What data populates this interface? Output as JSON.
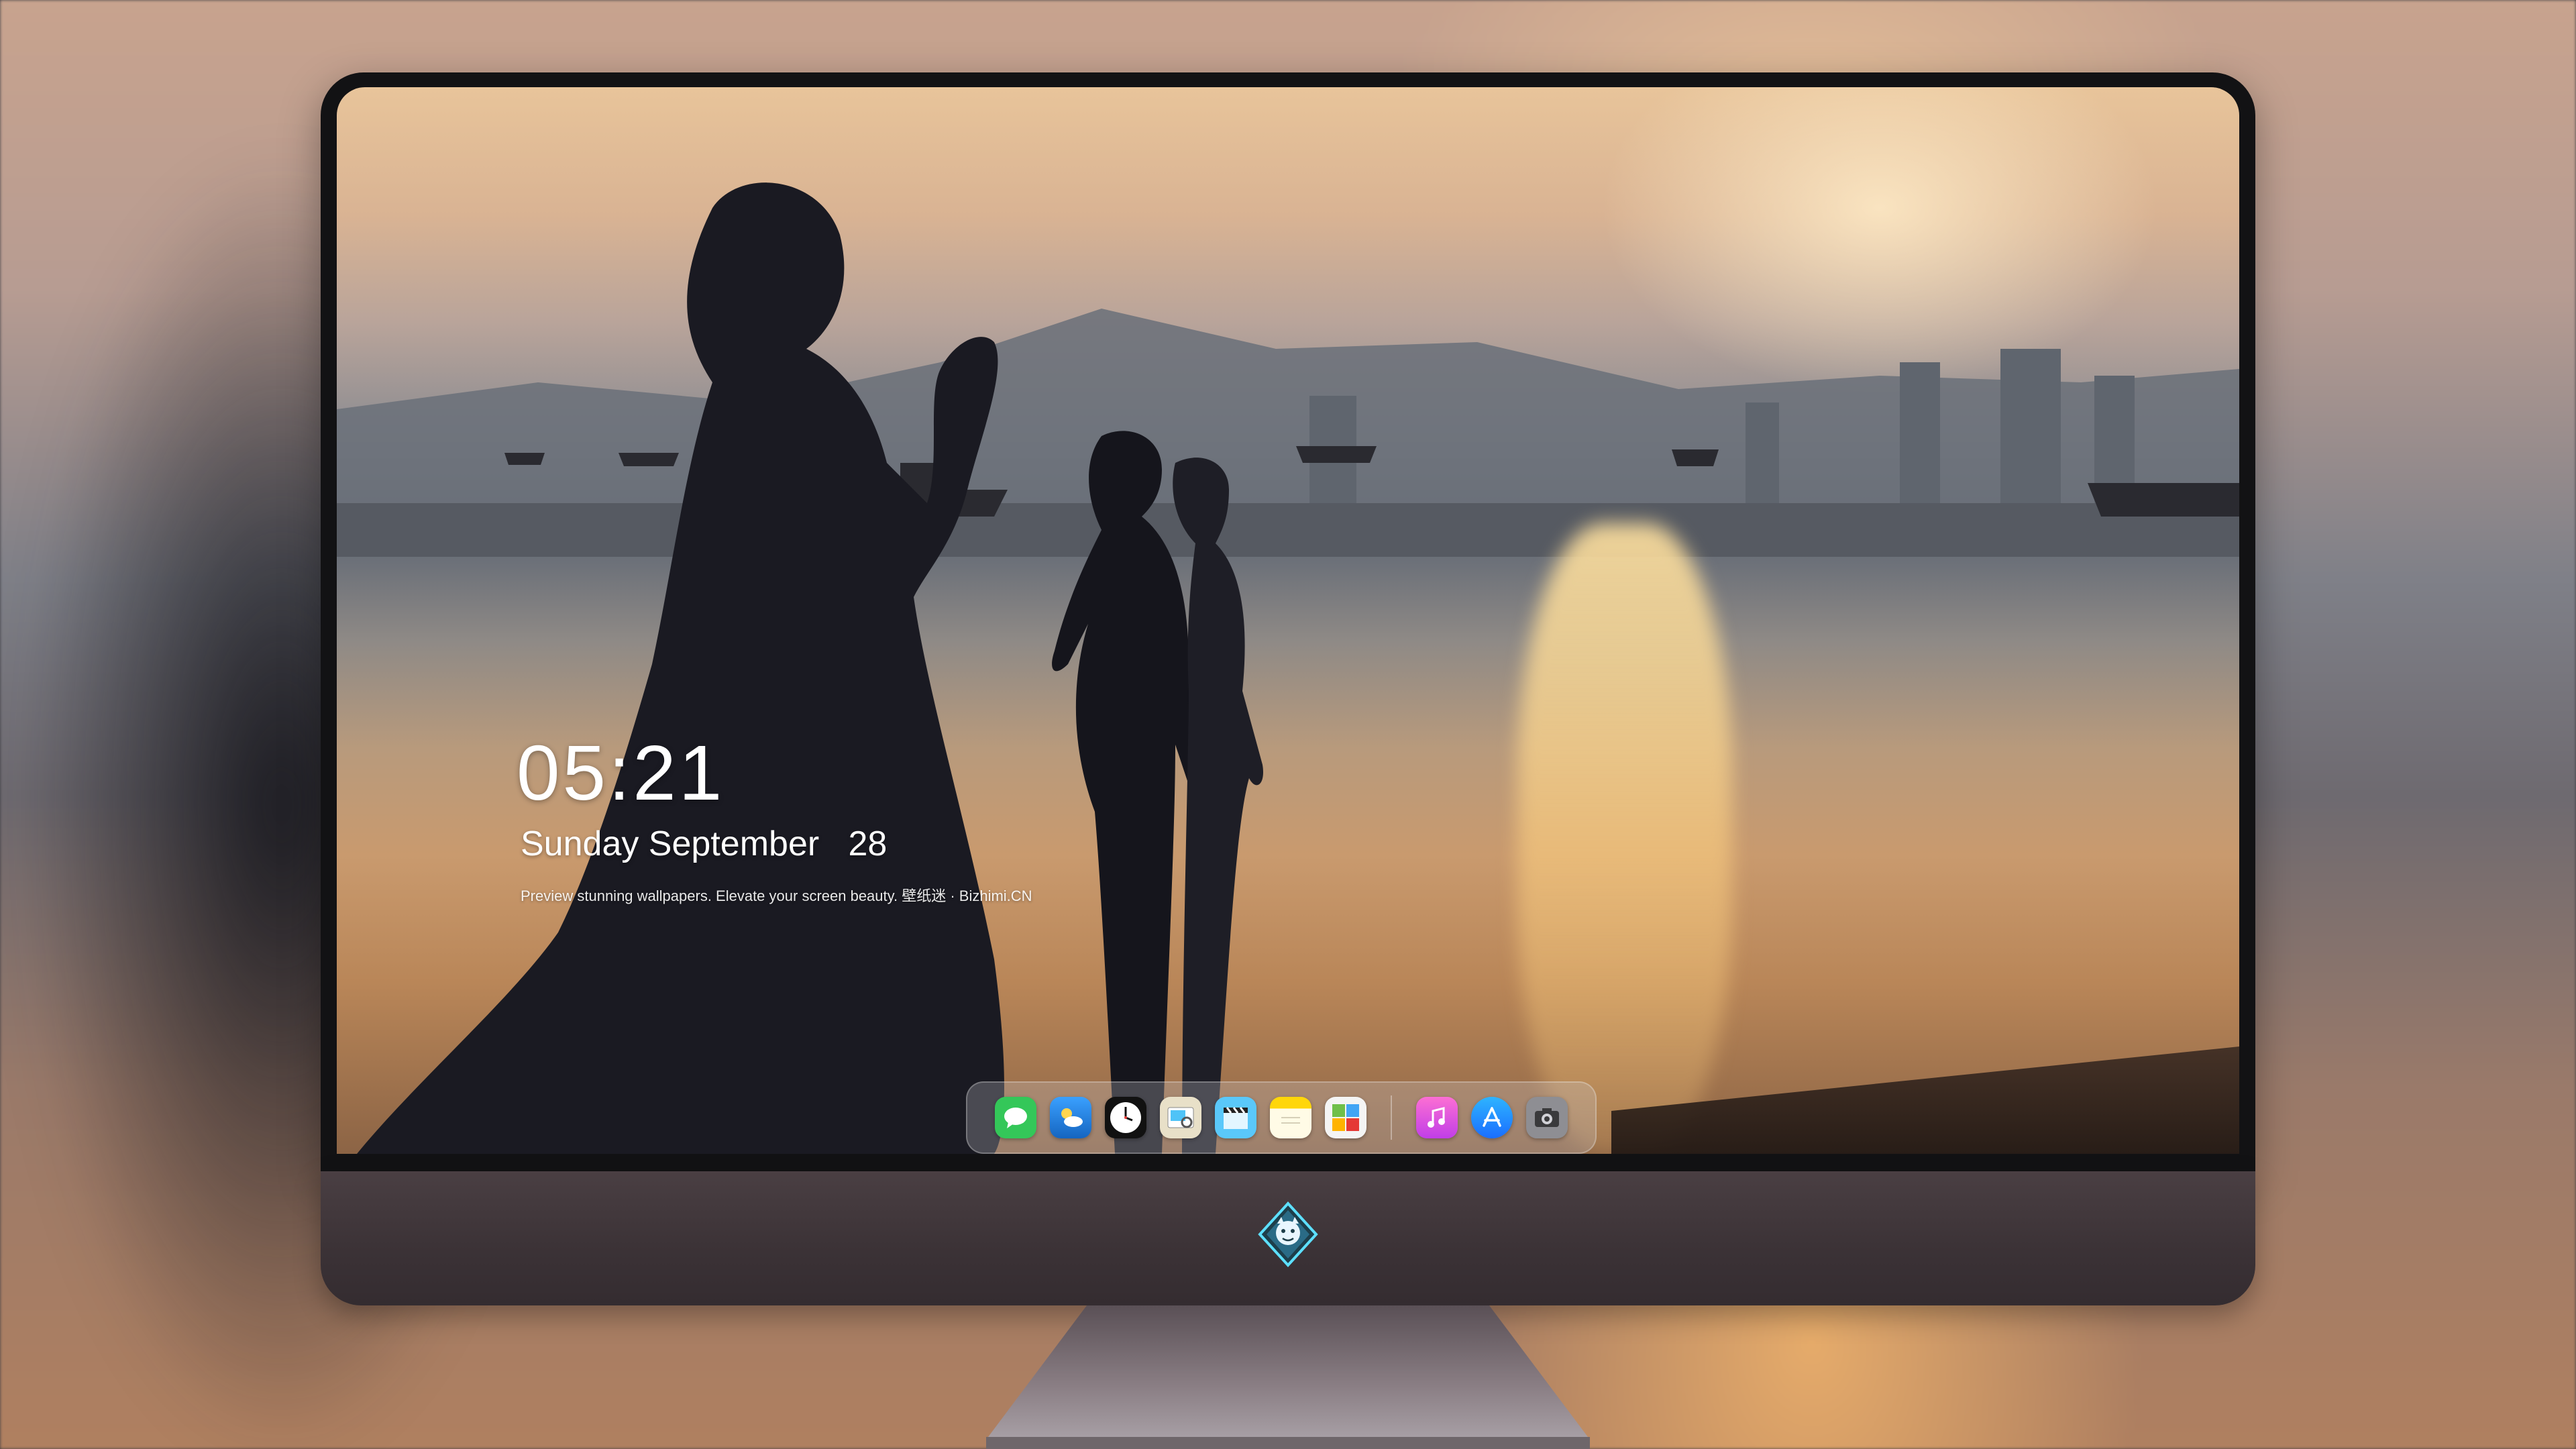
{
  "lock_screen": {
    "time": "05:21",
    "date": "Sunday September   28",
    "tagline": "Preview stunning wallpapers. Elevate your screen beauty. 壁纸迷 · Bizhimi.CN"
  },
  "dock": {
    "apps": [
      {
        "name": "Messages",
        "icon": "messages-icon",
        "color": "#34c759"
      },
      {
        "name": "Weather",
        "icon": "weather-icon",
        "color": "#1e88e5"
      },
      {
        "name": "Clock",
        "icon": "clock-icon",
        "color": "#111111"
      },
      {
        "name": "Preview",
        "icon": "preview-icon",
        "color": "#e8e0c8"
      },
      {
        "name": "Final Cut",
        "icon": "clapperboard-icon",
        "color": "#5ac8fa"
      },
      {
        "name": "Notes",
        "icon": "notes-icon",
        "color": "#ffd60a"
      },
      {
        "name": "Photo Booth",
        "icon": "photo-booth-icon",
        "color": "#6fbf4a"
      },
      {
        "name": "Music",
        "icon": "music-icon",
        "color": "#fa57c1"
      },
      {
        "name": "App Store",
        "icon": "app-store-icon",
        "color": "#1a8cff"
      },
      {
        "name": "Camera",
        "icon": "camera-icon",
        "color": "#8e8e93"
      }
    ]
  },
  "colors": {
    "bezel": "#121214",
    "chin": "#3b3236",
    "stand": "#7a6e74"
  }
}
